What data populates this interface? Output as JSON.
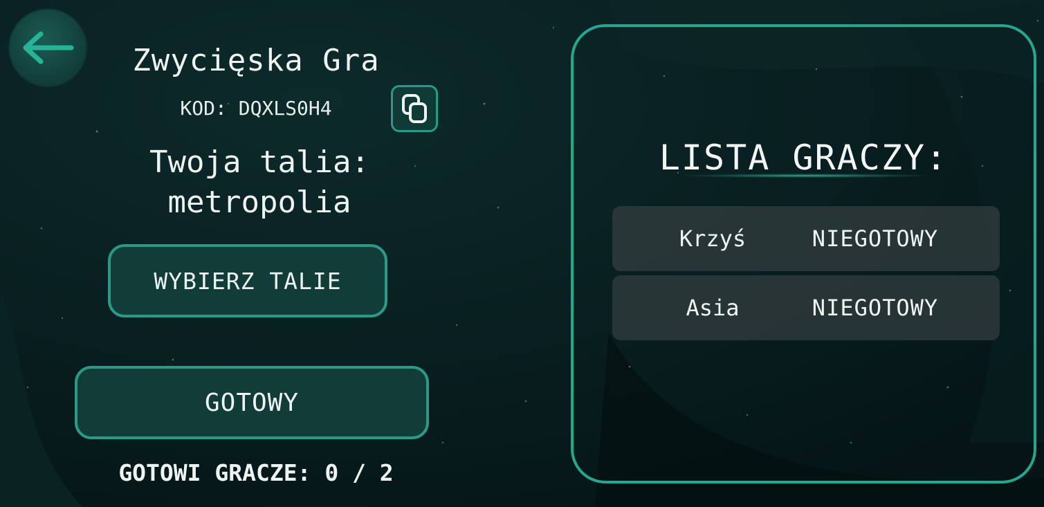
{
  "lobby": {
    "game_name": "Zwycięska Gra",
    "code_label": "KOD: DQXLS0H4",
    "deck_line1": "Twoja talia:",
    "deck_line2": "metropolia",
    "choose_deck_label": "WYBIERZ TALIE",
    "ready_label": "GOTOWY",
    "ready_count": "GOTOWI GRACZE: 0 / 2"
  },
  "players_panel": {
    "title": "LISTA GRACZY:",
    "players": [
      {
        "name": "Krzyś",
        "status": "NIEGOTOWY"
      },
      {
        "name": "Asia",
        "status": "NIEGOTOWY"
      }
    ]
  },
  "icons": {
    "back": "arrow-left-icon",
    "copy": "copy-icon"
  },
  "colors": {
    "background": "#061a1c",
    "accent": "#23a88f",
    "button_fill": "#113c38",
    "text": "#eef4f2"
  }
}
